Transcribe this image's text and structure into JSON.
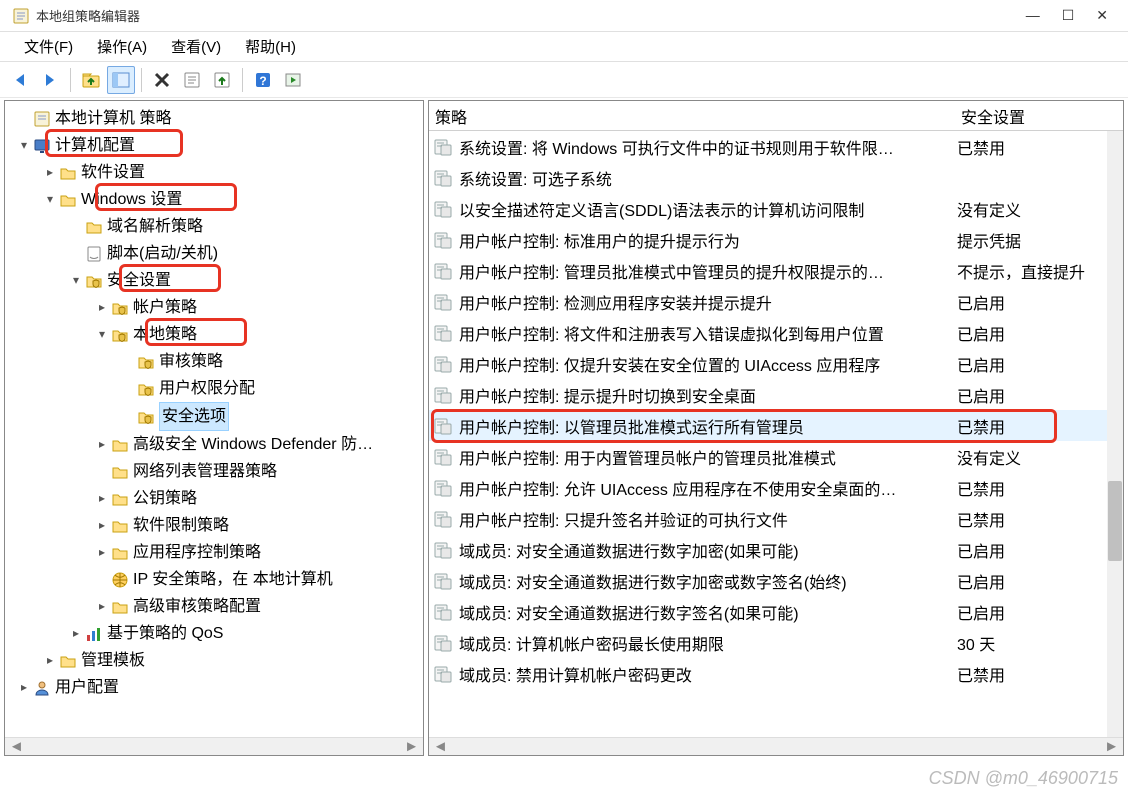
{
  "window": {
    "title": "本地组策略编辑器"
  },
  "win_controls": {
    "min": "—",
    "max": "☐",
    "close": "✕"
  },
  "menu": {
    "file": "文件(F)",
    "action": "操作(A)",
    "view": "查看(V)",
    "help": "帮助(H)"
  },
  "toolbar_icons": {
    "back": "back-arrow",
    "forward": "forward-arrow",
    "up": "folder-up",
    "show": "show-pane",
    "delete": "delete",
    "props": "properties",
    "export": "export-list",
    "help": "help",
    "run": "run"
  },
  "columns": {
    "policy": "策略",
    "setting": "安全设置"
  },
  "tree": {
    "root": "本地计算机 策略",
    "computer_config": "计算机配置",
    "software_settings": "软件设置",
    "windows_settings": "Windows 设置",
    "name_res": "域名解析策略",
    "scripts": "脚本(启动/关机)",
    "security_settings": "安全设置",
    "account_policy": "帐户策略",
    "local_policy": "本地策略",
    "audit_policy": "审核策略",
    "user_rights": "用户权限分配",
    "security_options": "安全选项",
    "defender": "高级安全 Windows Defender 防…",
    "nlm": "网络列表管理器策略",
    "pubkey": "公钥策略",
    "srp": "软件限制策略",
    "appctrl": "应用程序控制策略",
    "ipsec": "IP 安全策略，在 本地计算机",
    "advaudit": "高级审核策略配置",
    "qos": "基于策略的 QoS",
    "admin_templates": "管理模板",
    "user_config": "用户配置"
  },
  "policies": [
    {
      "name": "系统设置: 将 Windows 可执行文件中的证书规则用于软件限…",
      "value": "已禁用"
    },
    {
      "name": "系统设置: 可选子系统",
      "value": ""
    },
    {
      "name": "以安全描述符定义语言(SDDL)语法表示的计算机访问限制",
      "value": "没有定义"
    },
    {
      "name": "用户帐户控制: 标准用户的提升提示行为",
      "value": "提示凭据"
    },
    {
      "name": "用户帐户控制: 管理员批准模式中管理员的提升权限提示的…",
      "value": "不提示，直接提升"
    },
    {
      "name": "用户帐户控制: 检测应用程序安装并提示提升",
      "value": "已启用"
    },
    {
      "name": "用户帐户控制: 将文件和注册表写入错误虚拟化到每用户位置",
      "value": "已启用"
    },
    {
      "name": "用户帐户控制: 仅提升安装在安全位置的 UIAccess 应用程序",
      "value": "已启用"
    },
    {
      "name": "用户帐户控制: 提示提升时切换到安全桌面",
      "value": "已启用"
    },
    {
      "name": "用户帐户控制: 以管理员批准模式运行所有管理员",
      "value": "已禁用",
      "highlight": true
    },
    {
      "name": "用户帐户控制: 用于内置管理员帐户的管理员批准模式",
      "value": "没有定义"
    },
    {
      "name": "用户帐户控制: 允许 UIAccess 应用程序在不使用安全桌面的…",
      "value": "已禁用"
    },
    {
      "name": "用户帐户控制: 只提升签名并验证的可执行文件",
      "value": "已禁用"
    },
    {
      "name": "域成员: 对安全通道数据进行数字加密(如果可能)",
      "value": "已启用"
    },
    {
      "name": "域成员: 对安全通道数据进行数字加密或数字签名(始终)",
      "value": "已启用"
    },
    {
      "name": "域成员: 对安全通道数据进行数字签名(如果可能)",
      "value": "已启用"
    },
    {
      "name": "域成员: 计算机帐户密码最长使用期限",
      "value": "30 天"
    },
    {
      "name": "域成员: 禁用计算机帐户密码更改",
      "value": "已禁用"
    }
  ],
  "watermark": "CSDN @m0_46900715"
}
